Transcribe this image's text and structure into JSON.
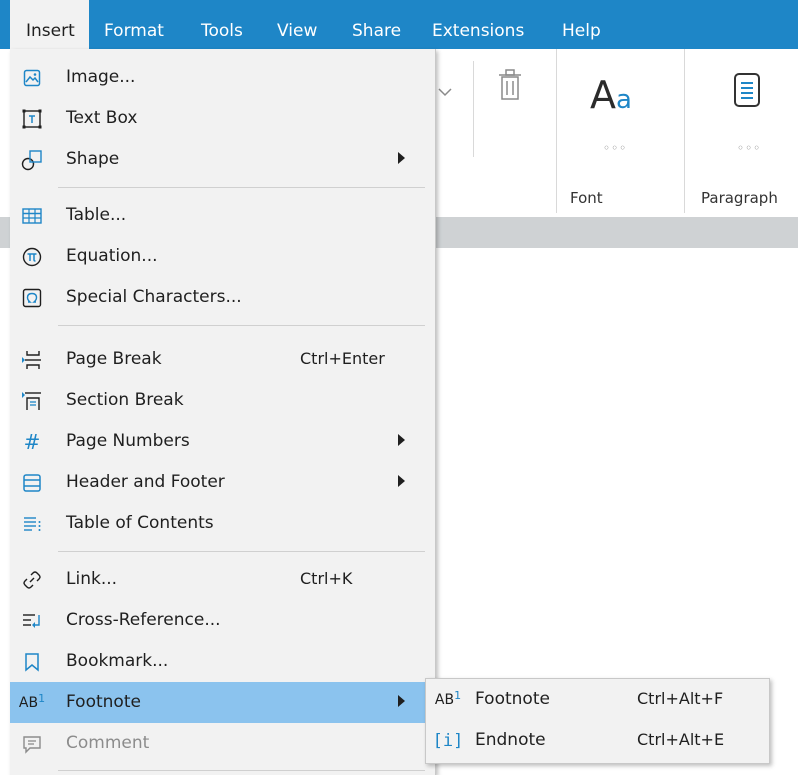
{
  "menubar": {
    "items": [
      {
        "label": "Insert"
      },
      {
        "label": "Format"
      },
      {
        "label": "Tools"
      },
      {
        "label": "View"
      },
      {
        "label": "Share"
      },
      {
        "label": "Extensions"
      },
      {
        "label": "Help"
      }
    ],
    "active": "Insert"
  },
  "ribbon": {
    "font_sample_big": "A",
    "font_sample_small": "a",
    "font_dots": "◦◦◦",
    "paragraph_dots": "◦◦◦",
    "font_group": "Font",
    "paragraph_group": "Paragraph"
  },
  "insert_menu": {
    "items": [
      {
        "label": "Image...",
        "icon": "image-icon"
      },
      {
        "label": "Text Box",
        "icon": "text-box-icon"
      },
      {
        "label": "Shape",
        "icon": "shape-icon",
        "submenu": true
      },
      {
        "label": "Table...",
        "icon": "table-icon"
      },
      {
        "label": "Equation...",
        "icon": "pi-icon"
      },
      {
        "label": "Special Characters...",
        "icon": "omega-icon"
      },
      {
        "label": "Page Break",
        "icon": "page-break-icon",
        "shortcut": "Ctrl+Enter"
      },
      {
        "label": "Section Break",
        "icon": "section-break-icon"
      },
      {
        "label": "Page Numbers",
        "icon": "hash-icon",
        "submenu": true
      },
      {
        "label": "Header and Footer",
        "icon": "header-footer-icon",
        "submenu": true
      },
      {
        "label": "Table of Contents",
        "icon": "toc-icon"
      },
      {
        "label": "Link...",
        "icon": "link-icon",
        "shortcut": "Ctrl+K"
      },
      {
        "label": "Cross-Reference...",
        "icon": "cross-reference-icon"
      },
      {
        "label": "Bookmark...",
        "icon": "bookmark-icon"
      },
      {
        "label": "Footnote",
        "icon": "footnote-icon",
        "submenu": true,
        "highlighted": true
      },
      {
        "label": "Comment",
        "icon": "comment-icon",
        "disabled": true
      }
    ]
  },
  "footnote_submenu": {
    "items": [
      {
        "label": "Footnote",
        "icon": "footnote-icon",
        "shortcut": "Ctrl+Alt+F"
      },
      {
        "label": "Endnote",
        "icon": "endnote-icon",
        "shortcut": "Ctrl+Alt+E"
      }
    ]
  },
  "colors": {
    "menubar": "#1e86c7",
    "menu_bg": "#f2f2f2",
    "highlight": "#8bc3ee",
    "icon_blue": "#1e86c7"
  }
}
